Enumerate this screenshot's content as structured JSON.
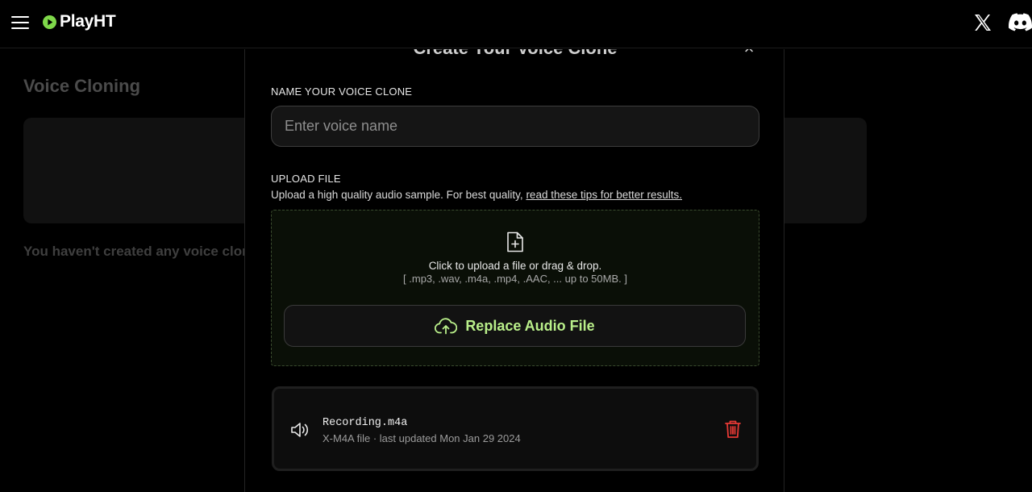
{
  "app": {
    "brand": "PlayHT"
  },
  "background": {
    "title": "Voice Cloning",
    "empty_text": "You haven't created any voice clones yet."
  },
  "modal": {
    "title": "Create Your Voice Clone",
    "close_label": "×",
    "name_label": "NAME YOUR VOICE CLONE",
    "name_placeholder": "Enter voice name",
    "name_value": "",
    "upload_label": "UPLOAD FILE",
    "upload_help": "Upload a high quality audio sample. For best quality, ",
    "upload_help_link": "read these tips for better results.",
    "drop_main": "Click to upload a file or drag & drop.",
    "drop_formats": "[ .mp3, .wav, .m4a, .mp4, .AAC, ... up to 50MB. ]",
    "replace_button": "Replace Audio File",
    "file": {
      "name": "Recording.m4a",
      "meta": "X-M4A file · last updated Mon Jan 29 2024"
    }
  },
  "colors": {
    "accent": "#b9ef8a",
    "brand_green": "#7fd84a",
    "danger": "#e53935"
  },
  "icons": [
    "menu-icon",
    "play-logo-icon",
    "x-logo-icon",
    "discord-icon",
    "close-icon",
    "file-add-icon",
    "cloud-upload-icon",
    "speaker-icon",
    "trash-icon"
  ]
}
